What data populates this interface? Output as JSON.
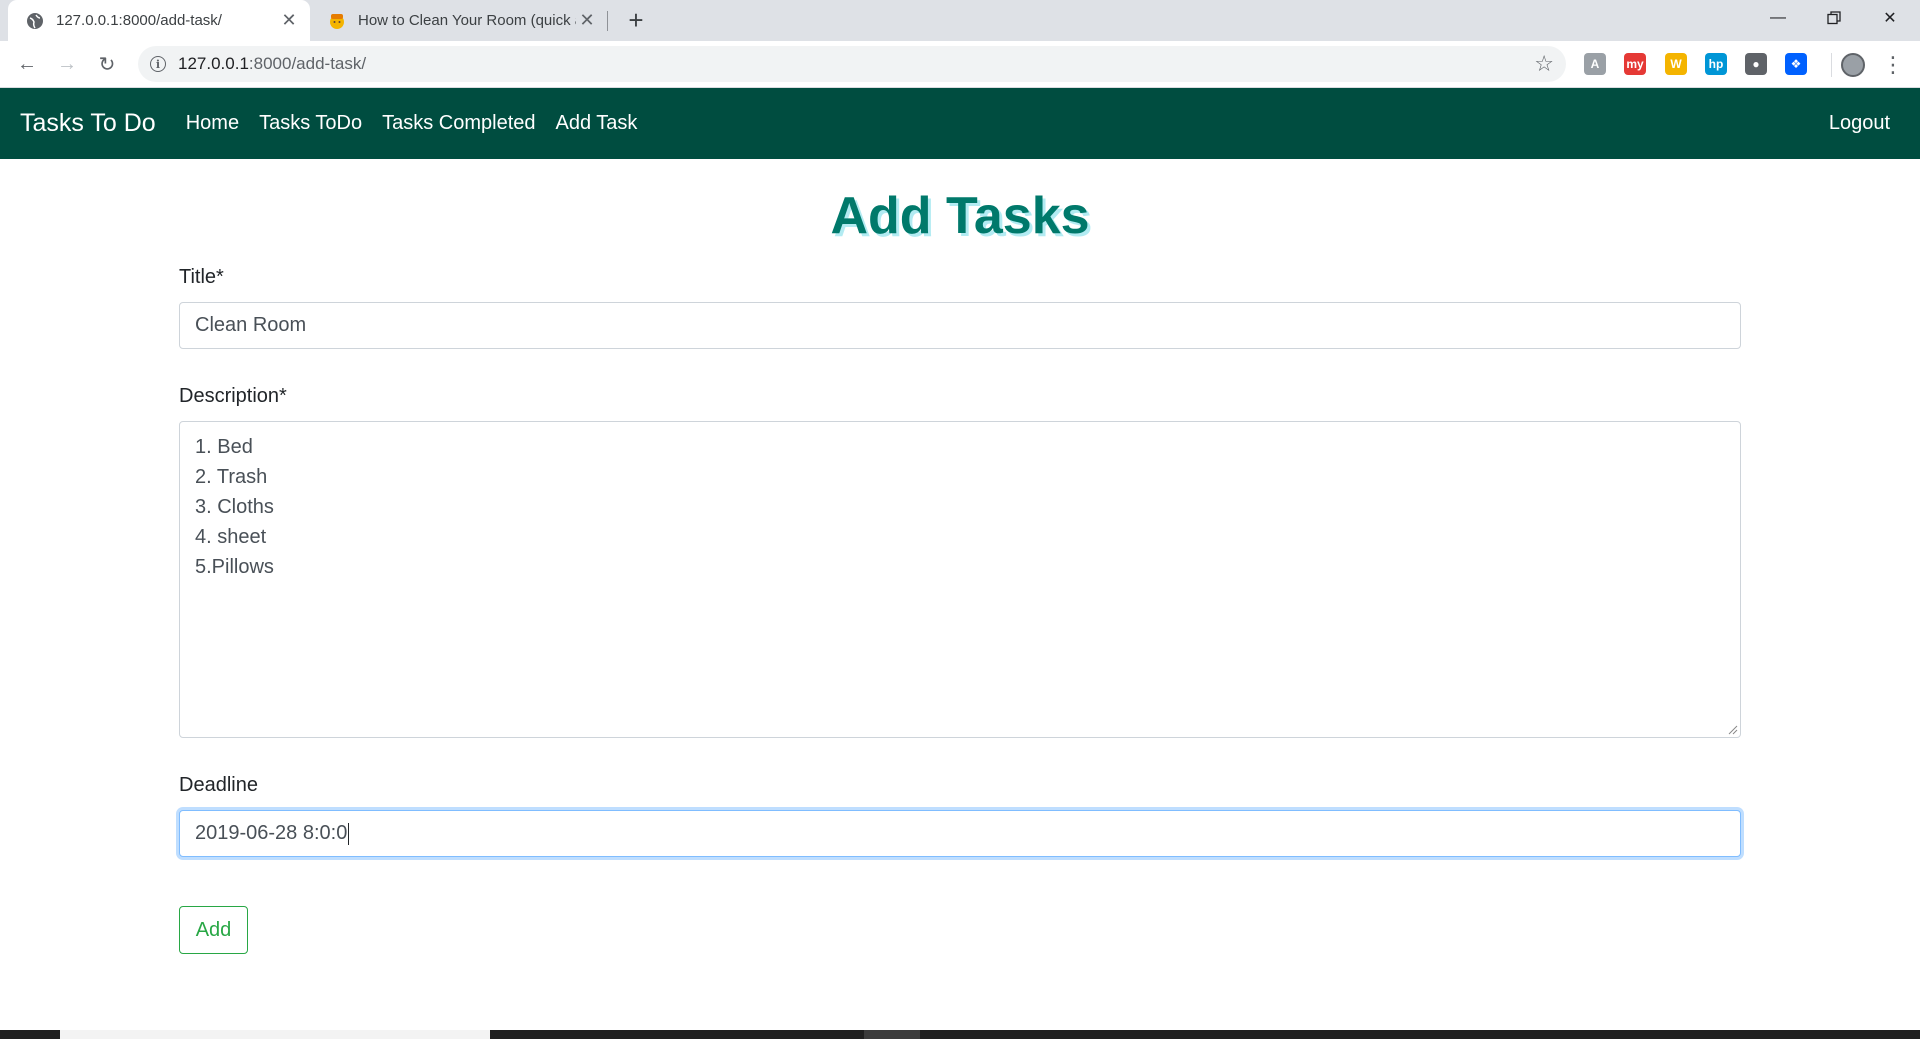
{
  "browser": {
    "tabs": [
      {
        "title": "127.0.0.1:8000/add-task/",
        "icon": "globe-icon",
        "active": true
      },
      {
        "title": "How to Clean Your Room (quick a",
        "icon": "emoji-favicon-icon",
        "active": false
      }
    ],
    "new_tab_icon": "plus-icon",
    "url_host": "127.0.0.1",
    "url_path": ":8000/add-task/",
    "extensions": [
      {
        "name": "extension-a-icon",
        "color": "#9aa0a6",
        "glyph": "A"
      },
      {
        "name": "extension-red-icon",
        "color": "#e53935",
        "glyph": "my"
      },
      {
        "name": "extension-w-icon",
        "color": "#f4b400",
        "glyph": "W"
      },
      {
        "name": "extension-hp-icon",
        "color": "#0096d6",
        "glyph": "hp"
      },
      {
        "name": "extension-circle-icon",
        "color": "#5f6368",
        "glyph": "●"
      },
      {
        "name": "dropbox-icon",
        "color": "#0061ff",
        "glyph": "❖"
      }
    ]
  },
  "navbar": {
    "brand": "Tasks To Do",
    "links": [
      "Home",
      "Tasks ToDo",
      "Tasks Completed",
      "Add Task"
    ],
    "logout": "Logout",
    "bg_color": "#004d40"
  },
  "page": {
    "title": "Add Tasks",
    "title_color": "#00796b"
  },
  "form": {
    "title_label": "Title*",
    "title_value": "Clean Room",
    "description_label": "Description*",
    "description_lines": [
      "1. Bed",
      "2. Trash",
      "3. Cloths",
      "4. sheet",
      "5.Pillows"
    ],
    "deadline_label": "Deadline",
    "deadline_value": "2019-06-28 8:0:0",
    "submit_label": "Add",
    "submit_color": "#28a745"
  }
}
